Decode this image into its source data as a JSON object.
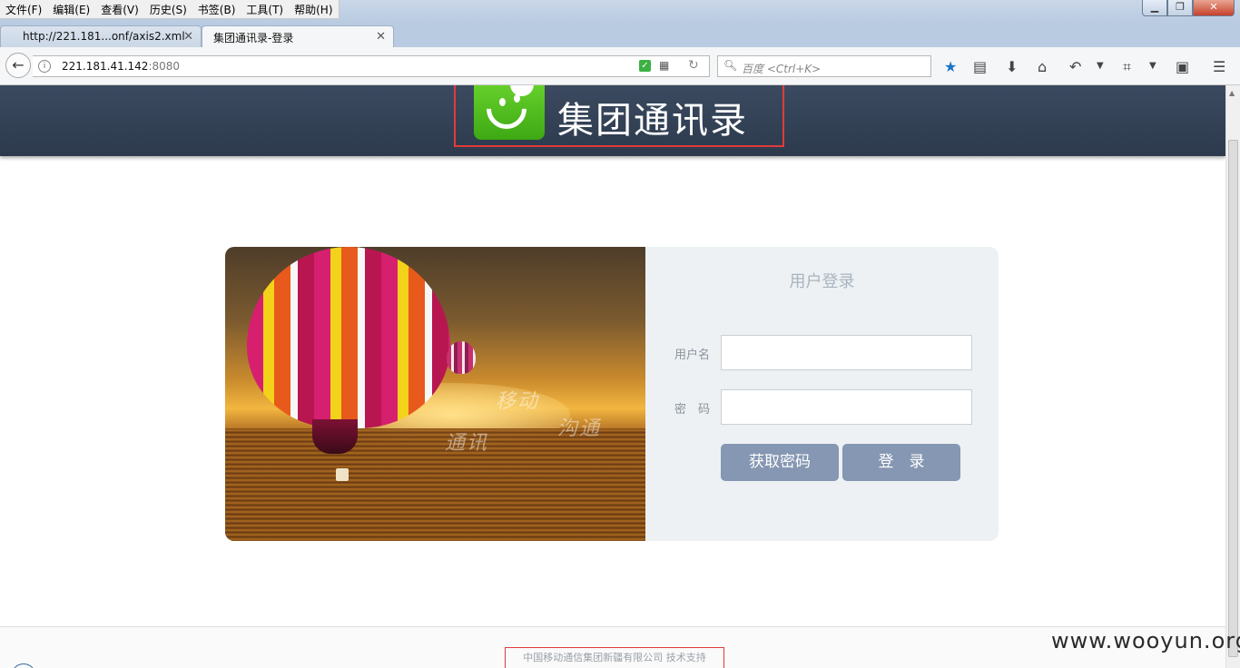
{
  "menu": {
    "items": [
      "文件(F)",
      "编辑(E)",
      "查看(V)",
      "历史(S)",
      "书签(B)",
      "工具(T)",
      "帮助(H)"
    ]
  },
  "window_controls": {
    "minimize": "▁",
    "maximize": "❐",
    "close": "✕"
  },
  "tabs": [
    {
      "title": "http://221.181...onf/axis2.xml",
      "active": false
    },
    {
      "title": "集团通讯录-登录",
      "active": true
    }
  ],
  "new_tab_label": "+",
  "address": {
    "host": "221.181.41.142",
    "port": ":8080"
  },
  "search": {
    "placeholder": "百度 <Ctrl+K>"
  },
  "icons": {
    "back": "back-arrow-icon",
    "info": "info-icon",
    "shield": "shield-icon",
    "qr": "qrcode-icon",
    "reload": "reload-icon",
    "search": "search-icon",
    "bookmark": "star-icon",
    "reader": "reader-icon",
    "download": "download-icon",
    "home": "home-icon",
    "undo": "undo-icon",
    "crop": "crop-icon",
    "screenshot": "screenshot-icon",
    "menu": "hamburger-icon"
  },
  "header": {
    "title": "集团通讯录"
  },
  "hero": {
    "words": [
      "移动",
      "沟通",
      "通讯"
    ]
  },
  "login": {
    "title": "用户登录",
    "username_label": "用户名",
    "username_value": "",
    "password_label": "密　码",
    "password_value": "",
    "get_password_button": "获取密码",
    "login_button": "登　录"
  },
  "footer": {
    "text": "中国移动通信集团新疆有限公司 技术支持"
  },
  "watermark": "www.wooyun.org",
  "colors": {
    "header_bg": "#34425a",
    "logo_green": "#4dbb1c",
    "button": "#8597b2",
    "highlight": "#e23a3a"
  }
}
